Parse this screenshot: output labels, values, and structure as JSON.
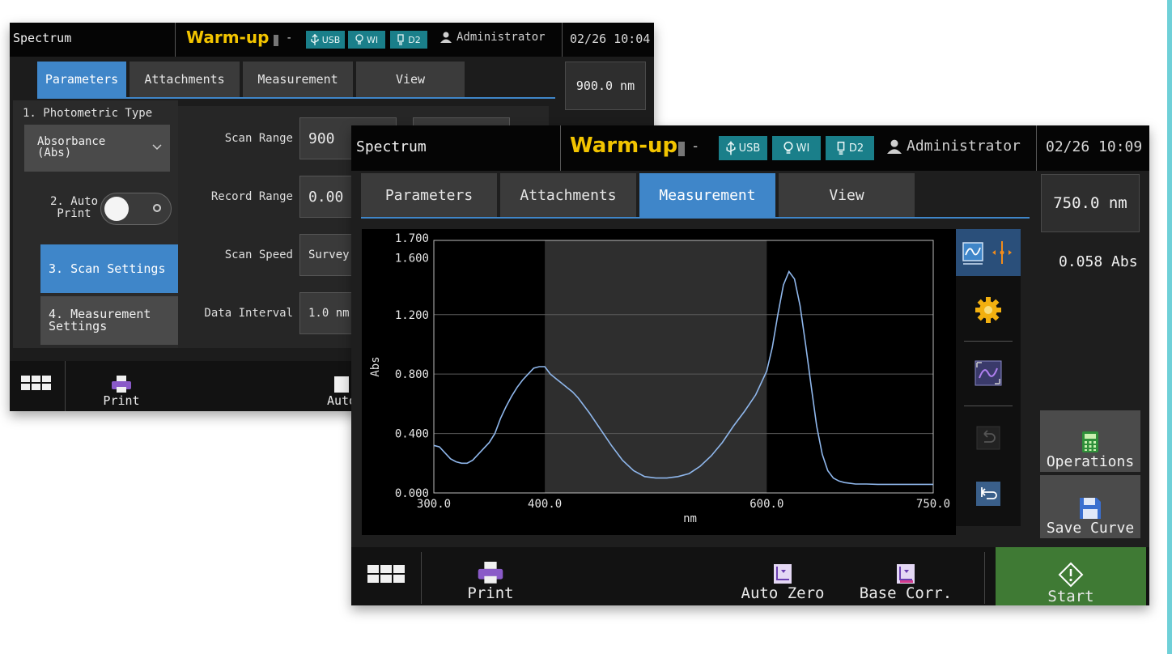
{
  "back_screen": {
    "header": {
      "title": "Spectrum",
      "status": "Warm-up",
      "lamp_value": "-",
      "badges": [
        "USB",
        "WI",
        "D2"
      ],
      "user": "Administrator",
      "clock": "02/26 10:04"
    },
    "tabs": [
      {
        "label": "Parameters",
        "active": true
      },
      {
        "label": "Attachments",
        "active": false
      },
      {
        "label": "Measurement",
        "active": false
      },
      {
        "label": "View",
        "active": false
      }
    ],
    "wavelength_readout": "900.0 nm",
    "sidebar": {
      "photometric_label": "1. Photometric Type",
      "photometric_value_line1": "Absorbance",
      "photometric_value_line2": "(Abs)",
      "auto_print_line1": "2. Auto",
      "auto_print_line2": "Print",
      "scan_settings": "3. Scan Settings",
      "measurement_settings_line1": "4. Measurement",
      "measurement_settings_line2": "Settings"
    },
    "params": [
      {
        "label": "Scan Range",
        "value": "900"
      },
      {
        "label": "Record Range",
        "value": "0.00"
      },
      {
        "label": "Scan Speed",
        "value": "Survey"
      },
      {
        "label": "Data Interval",
        "value": "1.0 nm"
      }
    ],
    "footer": {
      "print": "Print",
      "auto_partial": "Auto"
    }
  },
  "front_screen": {
    "header": {
      "title": "Spectrum",
      "status": "Warm-up",
      "lamp_value": "-",
      "badges": [
        "USB",
        "WI",
        "D2"
      ],
      "user": "Administrator",
      "clock": "02/26 10:09"
    },
    "tabs": [
      {
        "label": "Parameters",
        "active": false
      },
      {
        "label": "Attachments",
        "active": false
      },
      {
        "label": "Measurement",
        "active": true
      },
      {
        "label": "View",
        "active": false
      }
    ],
    "wavelength_readout": "750.0 nm",
    "abs_readout": "0.058 Abs",
    "operations": "Operations",
    "save_curve": "Save Curve",
    "footer": {
      "print": "Print",
      "auto_zero": "Auto Zero",
      "base_corr": "Base Corr.",
      "start": "Start"
    }
  },
  "colors": {
    "accent": "#3f86c9",
    "warmup": "#f2c400",
    "badge": "#1a7f8a",
    "start": "#3f7a34",
    "curve": "#8fb7ec"
  },
  "icons": [
    "grid-menu-icon",
    "printer-icon",
    "auto-zero-icon",
    "base-correction-icon",
    "start-diamond-icon",
    "calculator-icon",
    "floppy-disk-icon",
    "gear-icon",
    "zoom-fit-icon",
    "undo-icon",
    "reset-icon",
    "spectrum-cursor-icon",
    "usb-icon",
    "lamp-icon",
    "user-icon"
  ],
  "chart_data": {
    "type": "line",
    "title": "",
    "xlabel": "nm",
    "ylabel": "Abs",
    "xlim": [
      300,
      750
    ],
    "ylim": [
      0,
      1.7
    ],
    "x_ticks": [
      "300.0",
      "400.0",
      "600.0",
      "750.0"
    ],
    "x_tick_values": [
      300,
      400,
      600,
      750
    ],
    "y_ticks": [
      "0.000",
      "0.400",
      "0.800",
      "1.200",
      "1.600",
      "1.700"
    ],
    "y_tick_values": [
      0,
      0.4,
      0.8,
      1.2,
      1.6,
      1.7
    ],
    "highlight_range": [
      400,
      600
    ],
    "series": [
      {
        "x": [
          300,
          305,
          310,
          315,
          320,
          325,
          330,
          335,
          340,
          345,
          350,
          355,
          360,
          365,
          370,
          375,
          380,
          385,
          390,
          395,
          400,
          405,
          410,
          415,
          420,
          425,
          430,
          440,
          450,
          460,
          470,
          480,
          490,
          500,
          510,
          520,
          530,
          540,
          550,
          560,
          570,
          580,
          590,
          600,
          605,
          610,
          615,
          620,
          625,
          630,
          635,
          640,
          645,
          650,
          655,
          660,
          665,
          670,
          675,
          680,
          690,
          700,
          720,
          750
        ],
        "y": [
          0.32,
          0.31,
          0.27,
          0.23,
          0.21,
          0.2,
          0.2,
          0.22,
          0.26,
          0.3,
          0.34,
          0.4,
          0.5,
          0.58,
          0.65,
          0.71,
          0.76,
          0.8,
          0.84,
          0.85,
          0.85,
          0.8,
          0.77,
          0.74,
          0.71,
          0.68,
          0.64,
          0.54,
          0.43,
          0.32,
          0.22,
          0.15,
          0.11,
          0.1,
          0.1,
          0.11,
          0.13,
          0.18,
          0.25,
          0.34,
          0.45,
          0.55,
          0.66,
          0.82,
          0.98,
          1.2,
          1.4,
          1.49,
          1.44,
          1.26,
          1.0,
          0.72,
          0.45,
          0.26,
          0.15,
          0.1,
          0.08,
          0.07,
          0.065,
          0.06,
          0.06,
          0.058,
          0.058,
          0.058
        ]
      }
    ]
  }
}
